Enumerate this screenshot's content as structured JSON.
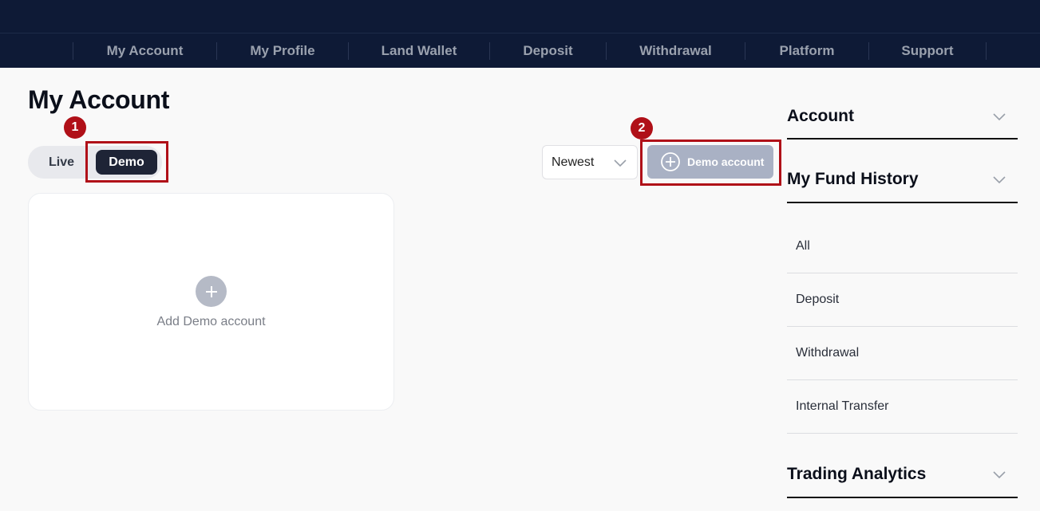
{
  "nav": {
    "items": [
      {
        "label": "My Account"
      },
      {
        "label": "My Profile"
      },
      {
        "label": "Land Wallet"
      },
      {
        "label": "Deposit"
      },
      {
        "label": "Withdrawal"
      },
      {
        "label": "Platform"
      },
      {
        "label": "Support"
      }
    ]
  },
  "page": {
    "title": "My Account"
  },
  "markers": {
    "m1": "1",
    "m2": "2"
  },
  "toggle": {
    "live_label": "Live",
    "demo_label": "Demo",
    "selected": "Demo"
  },
  "sort": {
    "value": "Newest"
  },
  "actions": {
    "demo_account_label": "Demo account"
  },
  "card": {
    "add_label": "Add Demo account"
  },
  "sidebar": {
    "account_title": "Account",
    "fund_history_title": "My Fund History",
    "fund_items": [
      {
        "label": "All"
      },
      {
        "label": "Deposit"
      },
      {
        "label": "Withdrawal"
      },
      {
        "label": "Internal Transfer"
      }
    ],
    "trading_title": "Trading Analytics"
  },
  "colors": {
    "topbar": "#0e1a36",
    "accent_marker": "#b01018",
    "demo_toggle": "#1e2436",
    "demo_button": "#a9b1c4"
  }
}
